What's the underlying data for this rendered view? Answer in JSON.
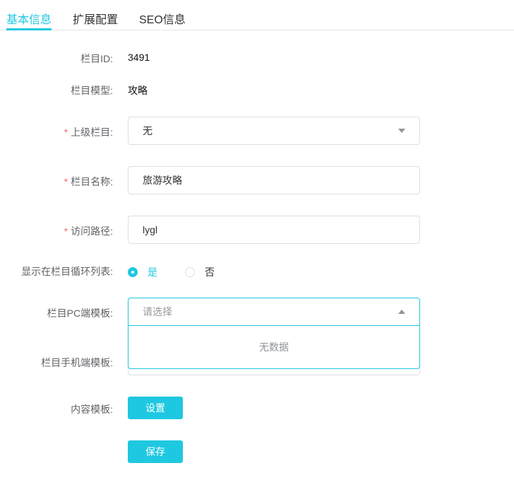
{
  "tabs": [
    "基本信息",
    "扩展配置",
    "SEO信息"
  ],
  "form": {
    "id_label": "栏目ID:",
    "id_value": "3491",
    "model_label": "栏目模型:",
    "model_value": "攻略",
    "parent_label": "上级栏目:",
    "parent_value": "无",
    "name_label": "栏目名称:",
    "name_value": "旅游攻略",
    "path_label": "访问路径:",
    "path_value": "lygl",
    "show_label": "显示在栏目循环列表:",
    "yes": "是",
    "no": "否",
    "pc_label": "栏目PC端模板:",
    "pc_placeholder": "请选择",
    "no_data": "无数据",
    "mobile_label": "栏目手机端模板:",
    "content_label": "内容模板:",
    "set_button": "设置",
    "save_button": "保存",
    "required_mark": "*"
  }
}
